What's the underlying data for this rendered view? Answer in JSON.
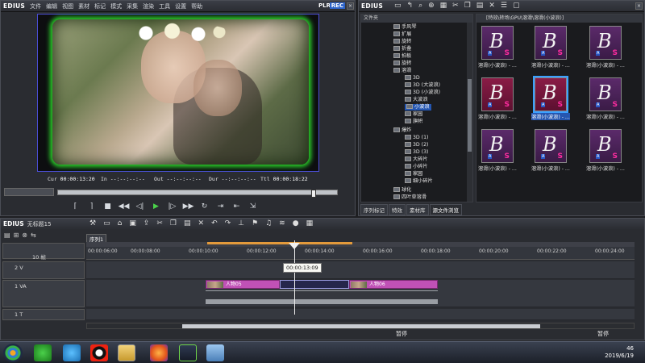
{
  "player": {
    "logo": "EDIUS",
    "menu": [
      "文件",
      "编辑",
      "视图",
      "素材",
      "标记",
      "模式",
      "采集",
      "渲染",
      "工具",
      "设置",
      "帮助"
    ],
    "plr": "PLR",
    "rec": "REC",
    "timecodes": {
      "cur_label": "Cur",
      "cur": "00:00:13:20",
      "in_label": "In",
      "in": "--:--:--:--",
      "out_label": "Out",
      "out": "--:--:--:--",
      "dur_label": "Dur",
      "dur": "--:--:--:--",
      "ttl_label": "Ttl",
      "ttl": "00:00:18:22"
    }
  },
  "bin": {
    "logo": "EDIUS",
    "tree_header": "文件夹",
    "grid_path": "[特效\\转场\\GPU\\溶滑\\溶滑(小波浪)]",
    "tree_nodes": [
      "手风琴",
      "扩展",
      "旋转",
      "折叠",
      "拍板",
      "旋转",
      "溶滑",
      "3D",
      "3D (大波浪)",
      "3D (小波浪)",
      "大波浪",
      "小波浪",
      "家园",
      "旗帜",
      "爆炸",
      "3D (1)",
      "3D (2)",
      "3D (3)",
      "大碎片",
      "小碎片",
      "家园",
      "细小碎片",
      "球化",
      "四叶草溶滑"
    ],
    "thumb_label": "溶滑(小波浪) - ...",
    "tabs": [
      "序列标记",
      "特效",
      "素材库",
      "源文件浏览"
    ]
  },
  "timeline": {
    "logo": "EDIUS",
    "sequence_name": "无标题15",
    "seq_tab": "序列1",
    "zoom": "10 帧",
    "ruler_ticks": [
      "00:00:06:00",
      "00:00:08:00",
      "00:00:10:00",
      "00:00:12:00",
      "00:00:14:00",
      "00:00:16:00",
      "00:00:18:00",
      "00:00:20:00",
      "00:00:22:00",
      "00:00:24:00"
    ],
    "tooltip": "00:00:13:09",
    "tracks": [
      {
        "name": "2 V"
      },
      {
        "name": "1 VA"
      },
      {
        "name": "1 T"
      }
    ],
    "clips": {
      "a": "人物05",
      "b": "人物06"
    },
    "status_left": "暂停",
    "status_right": "暂停"
  },
  "taskbar": {
    "time": "46",
    "date": "2019/6/19"
  }
}
